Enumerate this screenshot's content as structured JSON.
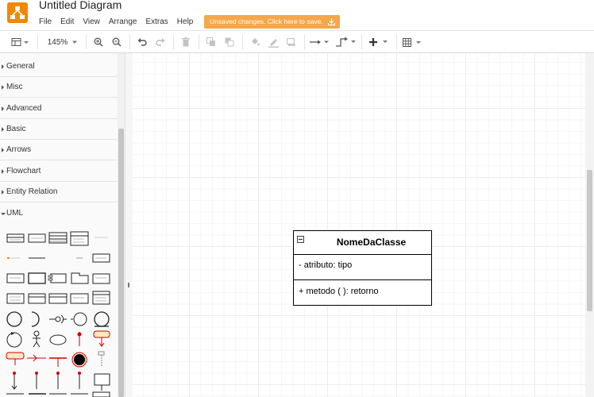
{
  "app": {
    "title": "Untitled Diagram",
    "logo_icon": "drawio-logo-icon",
    "brand_color": "#f08705"
  },
  "menu": {
    "items": [
      "File",
      "Edit",
      "View",
      "Arrange",
      "Extras",
      "Help"
    ]
  },
  "save_banner": {
    "text": "Unsaved changes. Click here to save.",
    "icon": "save-download-icon",
    "color": "#f5a74a"
  },
  "toolbar": {
    "zoom": "145%",
    "buttons": [
      "format-panel-icon",
      "zoom-in-icon",
      "zoom-out-icon",
      "undo-icon",
      "redo-icon",
      "delete-icon",
      "to-front-icon",
      "to-back-icon",
      "fill-color-icon",
      "line-color-icon",
      "shadow-icon",
      "connection-icon",
      "waypoints-icon",
      "insert-plus-icon",
      "table-icon"
    ]
  },
  "sidebar": {
    "sections": [
      {
        "label": "General",
        "open": false
      },
      {
        "label": "Misc",
        "open": false
      },
      {
        "label": "Advanced",
        "open": false
      },
      {
        "label": "Basic",
        "open": false
      },
      {
        "label": "Arrows",
        "open": false
      },
      {
        "label": "Flowchart",
        "open": false
      },
      {
        "label": "Entity Relation",
        "open": false
      },
      {
        "label": "UML",
        "open": true
      }
    ]
  },
  "diagram": {
    "uml_class": {
      "name": "NomeDaClasse",
      "attribute": "- atributo: tipo",
      "method": "+ metodo ( ): retorno"
    }
  }
}
